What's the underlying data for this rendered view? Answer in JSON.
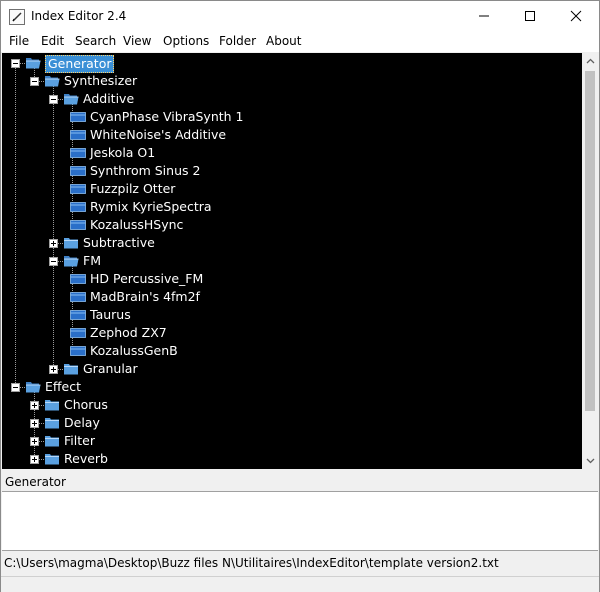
{
  "window": {
    "title": "Index Editor 2.4",
    "icon": "pencil-icon"
  },
  "menu": {
    "items": [
      "File",
      "Edit",
      "Search",
      "View",
      "Options",
      "Folder",
      "About"
    ]
  },
  "tree": {
    "nodes": [
      {
        "label": "Generator",
        "type": "folder",
        "expanded": true,
        "selected": true
      },
      {
        "label": "Synthesizer",
        "type": "folder",
        "expanded": true
      },
      {
        "label": "Additive",
        "type": "folder",
        "expanded": true
      },
      {
        "label": "CyanPhase VibraSynth 1",
        "type": "item"
      },
      {
        "label": "WhiteNoise's Additive",
        "type": "item"
      },
      {
        "label": "Jeskola O1",
        "type": "item"
      },
      {
        "label": "Synthrom Sinus 2",
        "type": "item"
      },
      {
        "label": "Fuzzpilz Otter",
        "type": "item"
      },
      {
        "label": "Rymix KyrieSpectra",
        "type": "item"
      },
      {
        "label": "KozalussHSync",
        "type": "item"
      },
      {
        "label": "Subtractive",
        "type": "folder",
        "expanded": false
      },
      {
        "label": "FM",
        "type": "folder",
        "expanded": true
      },
      {
        "label": "HD Percussive_FM",
        "type": "item"
      },
      {
        "label": "MadBrain's 4fm2f",
        "type": "item"
      },
      {
        "label": "Taurus",
        "type": "item"
      },
      {
        "label": "Zephod ZX7",
        "type": "item"
      },
      {
        "label": "KozalussGenB",
        "type": "item"
      },
      {
        "label": "Granular",
        "type": "folder",
        "expanded": false
      },
      {
        "label": "Effect",
        "type": "folder",
        "expanded": true
      },
      {
        "label": "Chorus",
        "type": "folder",
        "expanded": false
      },
      {
        "label": "Delay",
        "type": "folder",
        "expanded": false
      },
      {
        "label": "Filter",
        "type": "folder",
        "expanded": false
      },
      {
        "label": "Reverb",
        "type": "folder",
        "expanded": false
      }
    ]
  },
  "selection_label": "Generator",
  "description": "",
  "status": {
    "path": "C:\\Users\\magma\\Desktop\\Buzz files N\\Utilitaires\\IndexEditor\\template version2.txt"
  },
  "colors": {
    "tree_background": "#000000",
    "selection": "#3a8fd6",
    "folder": "#5aa0e0",
    "item_icon": "#2a6fc9"
  }
}
